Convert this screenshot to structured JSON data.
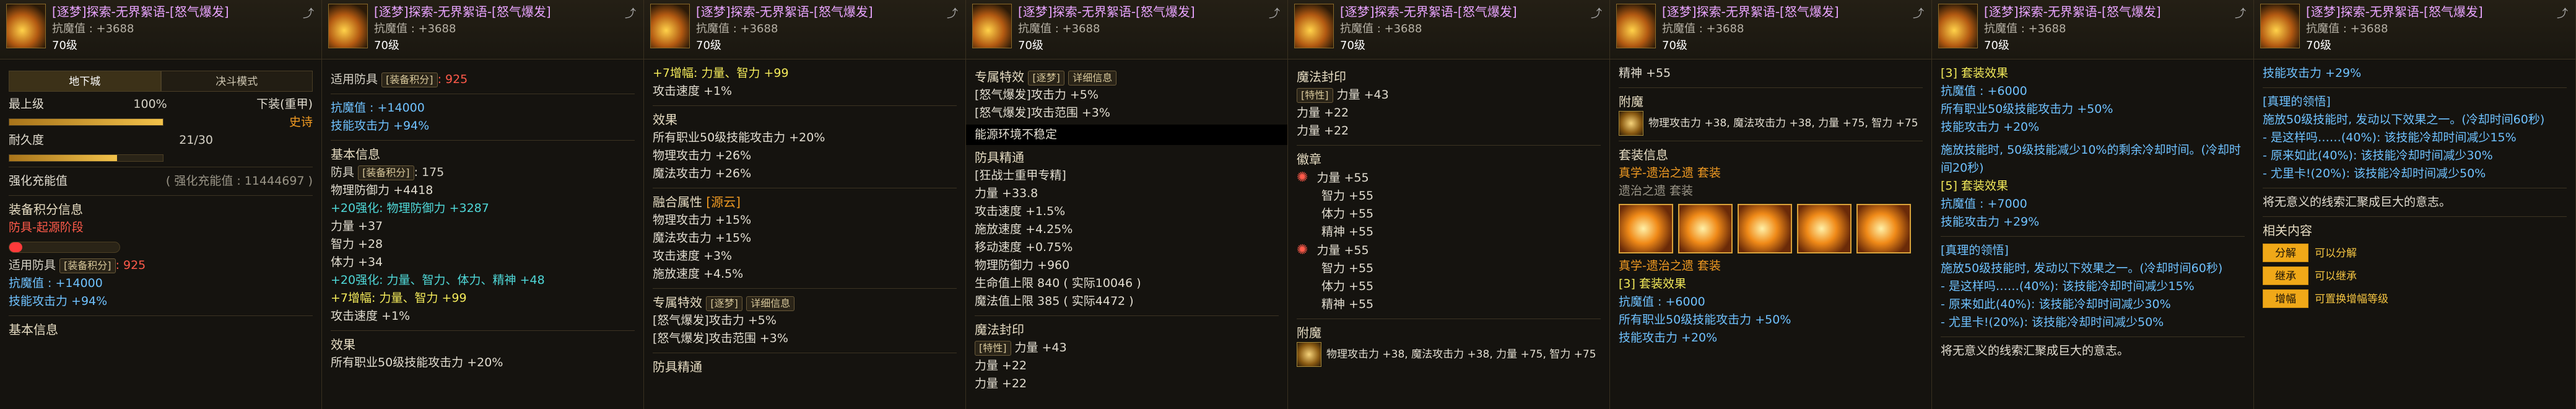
{
  "header": {
    "name": "[逐梦]探索-无界絮语-[怒气爆发]",
    "attack_label": "抗魔值 : +3688",
    "level": "70级",
    "share_icon": "share-icon"
  },
  "p1": {
    "tab_left": "地下城",
    "tab_right": "决斗模式",
    "max_label": "最上级",
    "max_pct": "100%",
    "max_fill": 1.0,
    "drop_label": "下装(重甲)",
    "drop_grade": "史诗",
    "dur_label": "耐久度",
    "dur_value": "21/30",
    "dur_fill": 0.7,
    "reinforce_label": "强化充能值",
    "reinforce_value": "( 强化充能值 : 11444697 )",
    "score_title": "装备积分信息",
    "score_stage": "防具-起源阶段",
    "score_fill": 0.12,
    "fit_label": "适用防具",
    "fit_tag": "[装备积分]",
    "fit_value": ": 925",
    "mag": "抗魔值 : +14000",
    "skill": "技能攻击力 +94%",
    "basic": "基本信息"
  },
  "p2": {
    "fit_label": "适用防具",
    "fit_tag": "[装备积分]",
    "fit_value": ": 925",
    "mag": "抗魔值 : +14000",
    "skill": "技能攻击力 +94%",
    "basic": "基本信息",
    "def_label": "防具",
    "def_tag": "[装备积分]",
    "def_value": ": 175",
    "phys_def": "物理防御力 +4418",
    "phys_bonus": "+20强化: 物理防御力 +3287",
    "str": "力量 +37",
    "int": "智力 +28",
    "vit": "体力 +34",
    "all_bonus": "+20强化: 力量、智力、体力、精神 +48",
    "amp_bonus": "+7增幅: 力量、智力 +99",
    "atk_speed": "攻击速度 +1%",
    "effect": "效果",
    "effect_line": "所有职业50级技能攻击力 +20%"
  },
  "p3": {
    "amp": "+7增幅: 力量、智力 +99",
    "atk_speed": "攻击速度 +1%",
    "effect": "效果",
    "e1": "所有职业50级技能攻击力 +20%",
    "e2": "物理攻击力 +26%",
    "e3": "魔法攻击力 +26%",
    "fusion": "融合属性",
    "fusion_tag": "[源云]",
    "f1": "物理攻击力 +15%",
    "f2": "魔法攻击力 +15%",
    "f3": "攻击速度 +3%",
    "f4": "施放速度 +4.5%",
    "special": "专属特效",
    "special_tag": "[逐梦]",
    "detail": "详细信息",
    "s1": "[怒气爆发]攻击力 +5%",
    "s2": "[怒气爆发]攻击范围 +3%",
    "armor": "防具精通"
  },
  "p4": {
    "special": "专属特效",
    "special_tag": "[逐梦]",
    "detail": "详细信息",
    "s1": "[怒气爆发]攻击力 +5%",
    "s2": "[怒气爆发]攻击范围 +3%",
    "unstable": "能源环境不稳定",
    "armor": "防具精通",
    "mastery": "[狂战士重甲专精]",
    "m1": "力量 +33.8",
    "m2": "攻击速度 +1.5%",
    "m3": "施放速度 +4.25%",
    "m4": "移动速度 +0.75%",
    "m5": "物理防御力 +960",
    "m6": "生命值上限 840 ( 实际10046 )",
    "m7": "魔法值上限 385 ( 实际4472 )",
    "seal": "魔法封印",
    "seal_tag": "[特性]",
    "seal_value": "力量 +43",
    "seal2": "力量 +22",
    "seal3": "力量 +22"
  },
  "p5": {
    "seal": "魔法封印",
    "seal_tag": "[特性]",
    "seal_value": "力量 +43",
    "str1": "力量 +22",
    "str2": "力量 +22",
    "badge": "徽章",
    "b1": "力量 +55",
    "b2": "智力 +55",
    "b3": "体力 +55",
    "b4": "精神 +55",
    "b5": "力量 +55",
    "b6": "智力 +55",
    "b7": "体力 +55",
    "b8": "精神 +55",
    "enchant": "附魔",
    "ench_line": "物理攻击力 +38, 魔法攻击力 +38, 力量 +75, 智力 +75"
  },
  "p6": {
    "spirit": "精神 +55",
    "enchant": "附魔",
    "ench_line": "物理攻击力 +38, 魔法攻击力 +38, 力量 +75, 智力 +75",
    "set_info": "套装信息",
    "set_name": "真学-遗治之遗 套装",
    "set_sub": "遗治之遗 套装",
    "set_name2": "真学-遗治之遗 套装",
    "set3": "[3] 套装效果",
    "set_mag": "抗魔值 : +6000",
    "set_skill": "所有职业50级技能攻击力 +50%",
    "set_atk": "技能攻击力 +20%"
  },
  "p7": {
    "set_title": "[3] 套装效果",
    "mag": "抗魔值 : +6000",
    "skill": "所有职业50级技能攻击力 +50%",
    "atk": "技能攻击力 +20%",
    "cast_line": "施放技能时, 50级技能减少10%的剩余冷却时间。(冷却时间20秒)",
    "set5": "[5] 套装效果",
    "mag5": "抗魔值 : +7000",
    "atk5": "技能攻击力 +29%",
    "truth": "[真理的领悟]",
    "truth_line": "施放50级技能时, 发动以下效果之一。(冷却时间60秒)",
    "t1": "- 是这样吗……(40%): 该技能冷却时间减少15%",
    "t2": "- 原来如此(40%): 该技能冷却时间减少30%",
    "t3": "- 尤里卡!(20%): 该技能冷却时间减少50%",
    "end": "将无意义的线索汇聚成巨大的意志。"
  },
  "p8": {
    "top": "技能攻击力 +29%",
    "truth": "[真理的领悟]",
    "truth_line": "施放50级技能时, 发动以下效果之一。(冷却时间60秒)",
    "t1": "- 是这样吗……(40%): 该技能冷却时间减少15%",
    "t2": "- 原来如此(40%): 该技能冷却时间减少30%",
    "t3": "- 尤里卡!(20%): 该技能冷却时间减少50%",
    "end": "将无意义的线索汇聚成巨大的意志。",
    "related": "相关内容",
    "btn1": "分解",
    "btn2": "继承",
    "btn3": "增幅",
    "lnk1": "可以分解",
    "lnk2": "可以继承",
    "lnk3": "可置换增幅等级"
  },
  "colors": {
    "accent": "#f0a818",
    "epic_text": "#e9a4ff",
    "blue_text": "#6fc2ff",
    "orange_text": "#f09a22"
  }
}
